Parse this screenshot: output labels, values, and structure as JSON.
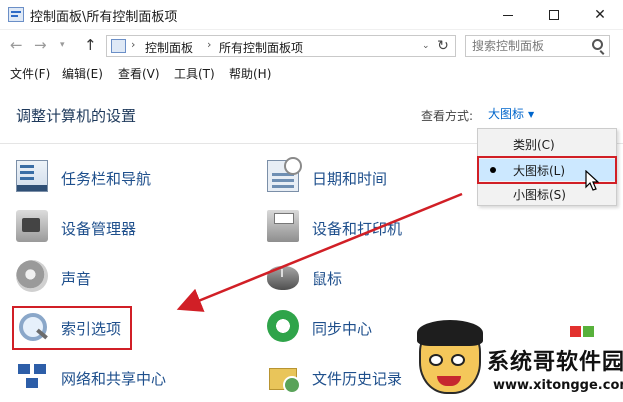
{
  "window": {
    "title": "控制面板\\所有控制面板项"
  },
  "address": {
    "crumbs": [
      "控制面板",
      "所有控制面板项"
    ]
  },
  "search": {
    "placeholder": "搜索控制面板"
  },
  "menu": [
    "文件(F)",
    "编辑(E)",
    "查看(V)",
    "工具(T)",
    "帮助(H)"
  ],
  "page": {
    "heading": "调整计算机的设置",
    "view_label": "查看方式:",
    "view_value": "大图标"
  },
  "view_menu": {
    "options": [
      "类别(C)",
      "大图标(L)",
      "小图标(S)"
    ],
    "selected": "大图标(L)"
  },
  "items": [
    {
      "label": "任务栏和导航",
      "icon": "taskbar-icon"
    },
    {
      "label": "日期和时间",
      "icon": "calendar-clock-icon"
    },
    {
      "label": "设备管理器",
      "icon": "device-manager-icon"
    },
    {
      "label": "设备和打印机",
      "icon": "printer-icon"
    },
    {
      "label": "声音",
      "icon": "speaker-icon"
    },
    {
      "label": "鼠标",
      "icon": "mouse-icon"
    },
    {
      "label": "索引选项",
      "icon": "magnifier-icon"
    },
    {
      "label": "同步中心",
      "icon": "sync-icon"
    },
    {
      "label": "网络和共享中心",
      "icon": "network-icon"
    },
    {
      "label": "文件历史记录",
      "icon": "file-history-icon"
    }
  ],
  "watermark": {
    "title": "系统哥软件园",
    "url": "www.xitongge.com"
  },
  "colors": {
    "annotation_red": "#d11f26",
    "link_blue": "#1e4f8c",
    "selection": "#cce8ff"
  }
}
